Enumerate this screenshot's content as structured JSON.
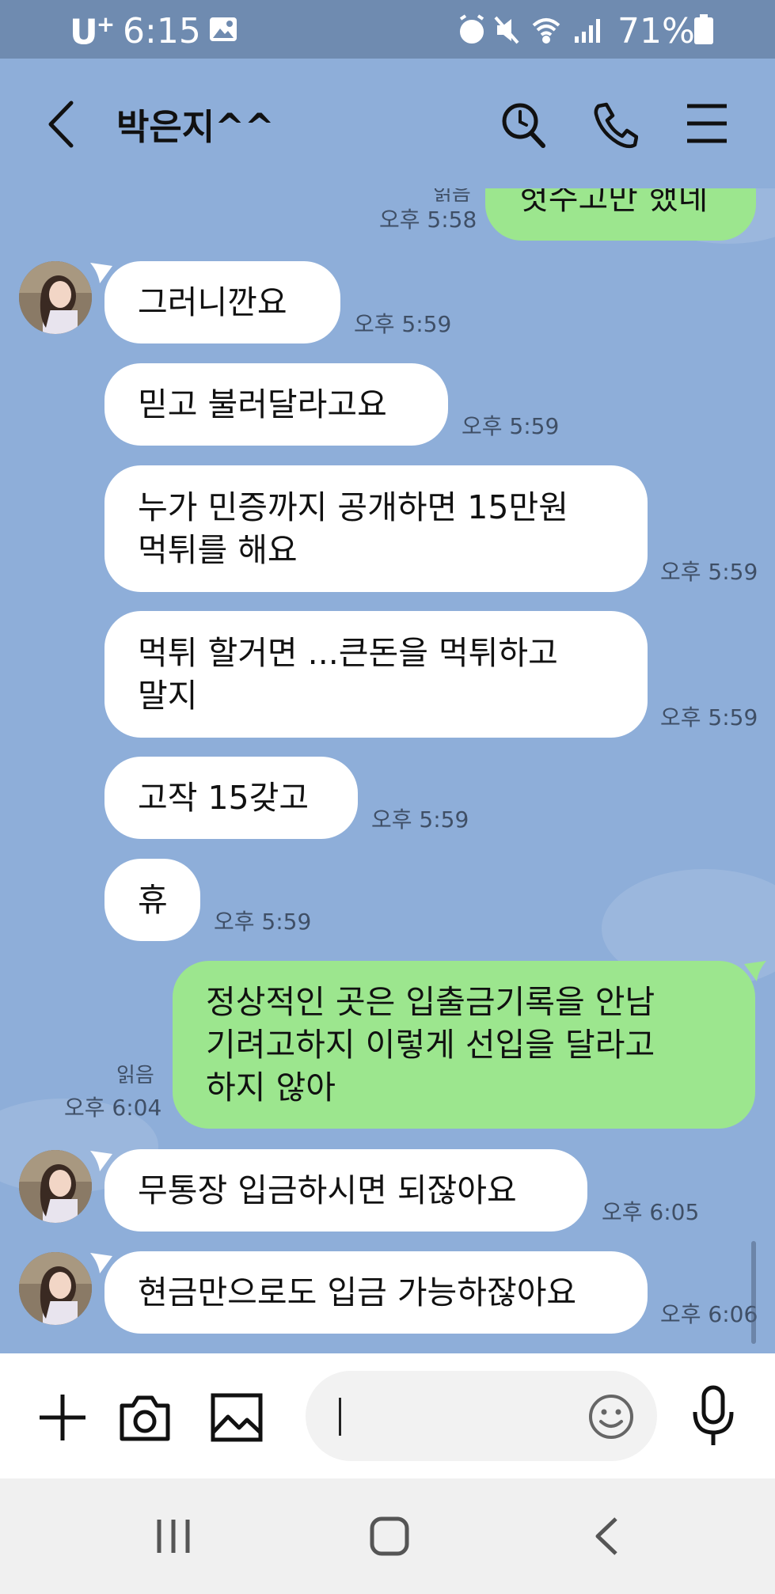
{
  "status_bar": {
    "carrier": "U",
    "carrier_plus": "+",
    "time": "6:15",
    "battery": "71%"
  },
  "header": {
    "contact_name": "박은지^^"
  },
  "messages": [
    {
      "text": "헛수고만 했네",
      "time": "오후 5:58",
      "read": "읽음"
    },
    {
      "text": "그러니깐요",
      "time": "오후 5:59"
    },
    {
      "text": "믿고 불러달라고요",
      "time": "오후 5:59"
    },
    {
      "text": "누가 민증까지 공개하면 15만원 먹튀를 해요",
      "time": "오후 5:59"
    },
    {
      "text": "먹튀 할거면 ...큰돈을 먹튀하고 말지",
      "time": "오후 5:59"
    },
    {
      "text": "고작 15갖고",
      "time": "오후 5:59"
    },
    {
      "text": "휴",
      "time": "오후 5:59"
    },
    {
      "text": "정상적인 곳은 입출금기록을 안남기려고하지 이렇게 선입을 달라고 하지 않아",
      "time": "오후 6:04",
      "read": "읽음"
    },
    {
      "text": "무통장 입금하시면 되잖아요",
      "time": "오후 6:05"
    },
    {
      "text": "현금만으로도 입금 가능하잖아요",
      "time": "오후 6:06"
    }
  ],
  "colors": {
    "chat_bg": "#8eaed9",
    "status_bg": "#6f8bb0",
    "incoming_bubble": "#ffffff",
    "outgoing_bubble": "#9ce68e"
  },
  "icons": {
    "header": [
      "back-arrow-icon",
      "search-icon",
      "phone-icon",
      "menu-icon"
    ],
    "input": [
      "plus-icon",
      "camera-icon",
      "image-icon",
      "emoji-icon",
      "mic-icon"
    ],
    "nav": [
      "recent-apps-icon",
      "home-icon",
      "back-icon"
    ]
  }
}
